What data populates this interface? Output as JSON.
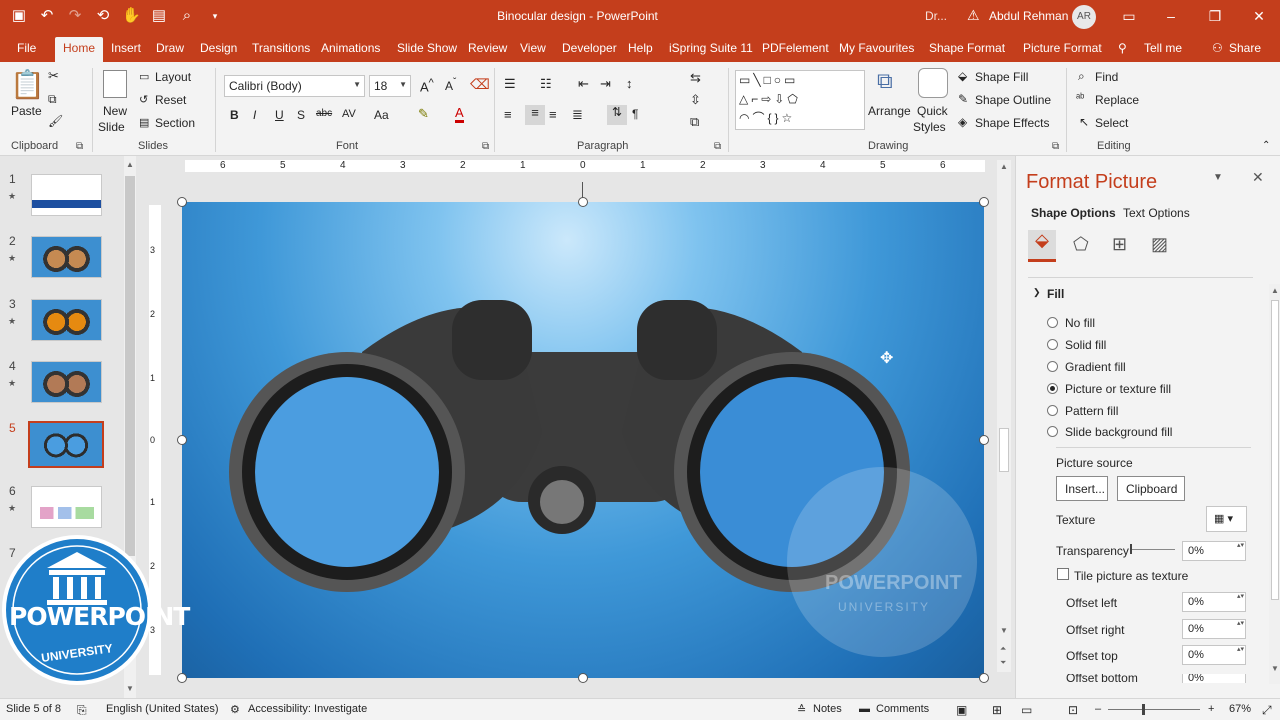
{
  "titlebar": {
    "title": "Binocular design  -  PowerPoint",
    "dr_label": "Dr...",
    "user_name": "Abdul Rehman",
    "avatar_initials": "AR"
  },
  "tabs": [
    "File",
    "Home",
    "Insert",
    "Draw",
    "Design",
    "Transitions",
    "Animations",
    "Slide Show",
    "Review",
    "View",
    "Developer",
    "Help",
    "iSpring Suite 11",
    "PDFelement",
    "My Favourites",
    "Shape Format",
    "Picture Format",
    "Tell me",
    "Share"
  ],
  "active_tab": "Home",
  "ribbon": {
    "clipboard": {
      "paste": "Paste",
      "label": "Clipboard"
    },
    "slides": {
      "new_slide_1": "New",
      "new_slide_2": "Slide",
      "layout": "Layout",
      "reset": "Reset",
      "section": "Section",
      "label": "Slides"
    },
    "font": {
      "name": "Calibri (Body)",
      "size": "18",
      "bold": "B",
      "italic": "I",
      "underline": "U",
      "strike": "S",
      "label": "Font"
    },
    "paragraph": {
      "label": "Paragraph"
    },
    "drawing": {
      "arrange": "Arrange",
      "quick_styles_1": "Quick",
      "quick_styles_2": "Styles",
      "shape_fill": "Shape Fill",
      "shape_outline": "Shape Outline",
      "shape_effects": "Shape Effects",
      "label": "Drawing"
    },
    "editing": {
      "find": "Find",
      "replace": "Replace",
      "select": "Select",
      "label": "Editing"
    }
  },
  "thumbnails": [
    {
      "num": "1",
      "star": "★"
    },
    {
      "num": "2",
      "star": "★"
    },
    {
      "num": "3",
      "star": "★"
    },
    {
      "num": "4",
      "star": "★"
    },
    {
      "num": "5",
      "star": ""
    },
    {
      "num": "6",
      "star": "★"
    },
    {
      "num": "7",
      "star": ""
    }
  ],
  "ruler": {
    "h": [
      "6",
      "5",
      "4",
      "3",
      "2",
      "1",
      "0",
      "1",
      "2",
      "3",
      "4",
      "5",
      "6"
    ],
    "v": [
      "3",
      "2",
      "1",
      "0",
      "1",
      "2",
      "3"
    ]
  },
  "pane": {
    "title": "Format Picture",
    "shape_options": "Shape Options",
    "text_options": "Text Options",
    "section_fill": "Fill",
    "fill_options": [
      "No fill",
      "Solid fill",
      "Gradient fill",
      "Picture or texture fill",
      "Pattern fill",
      "Slide background fill"
    ],
    "selected_fill": "Picture or texture fill",
    "picture_source": "Picture source",
    "insert_btn": "Insert...",
    "clipboard_btn": "Clipboard",
    "texture": "Texture",
    "transparency": "Transparency",
    "transparency_value": "0%",
    "tile": "Tile picture as texture",
    "offset_left": "Offset left",
    "offset_left_value": "0%",
    "offset_right": "Offset right",
    "offset_right_value": "0%",
    "offset_top": "Offset top",
    "offset_top_value": "0%",
    "offset_bottom": "Offset bottom",
    "offset_bottom_value": "0%"
  },
  "status": {
    "slide_info": "Slide 5 of 8",
    "language": "English (United States)",
    "accessibility": "Accessibility: Investigate",
    "notes": "Notes",
    "comments": "Comments",
    "zoom": "67%"
  },
  "logo": {
    "line1": "POWERPOINT",
    "line2": "UNIVERSITY"
  },
  "watermark": {
    "line1": "POWERPOINT",
    "line2": "UNIVERSITY"
  },
  "colors": {
    "accent": "#c43e1c",
    "slide_bg": "#3f98d8"
  }
}
